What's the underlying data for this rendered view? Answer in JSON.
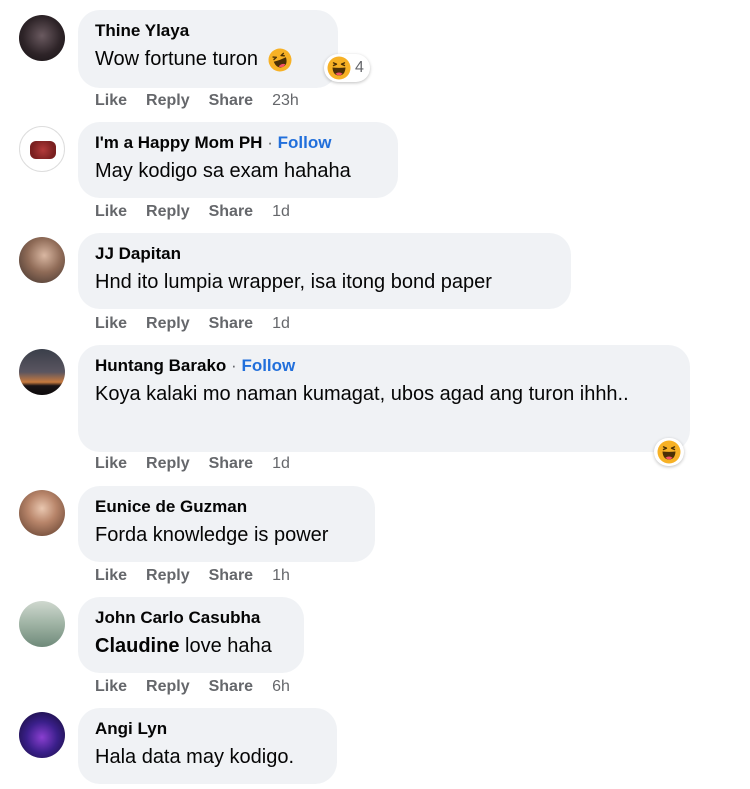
{
  "actions": {
    "like": "Like",
    "reply": "Reply",
    "share": "Share"
  },
  "comments": [
    {
      "author": "Thine Ylaya",
      "text": "Wow fortune turon",
      "time": "23h",
      "reaction_count": "4"
    },
    {
      "author": "I'm a Happy Mom PH",
      "follow": "Follow",
      "separator": "·",
      "text": "May kodigo sa exam hahaha",
      "time": "1d"
    },
    {
      "author": "JJ Dapitan",
      "text": "Hnd ito lumpia wrapper, isa itong bond paper",
      "time": "1d"
    },
    {
      "author": "Huntang Barako",
      "follow": "Follow",
      "separator": "·",
      "text": "Koya kalaki mo naman kumagat, ubos agad ang turon ihhh..",
      "time": "1d"
    },
    {
      "author": "Eunice de Guzman",
      "text": "Forda knowledge is power",
      "time": "1h"
    },
    {
      "author": "John Carlo Casubha",
      "mention": "Claudine",
      "text": " love haha",
      "time": "6h"
    },
    {
      "author": "Angi Lyn",
      "text": "Hala data may kodigo."
    }
  ],
  "colors": {
    "bubble": "#f0f2f5",
    "meta": "#65676b",
    "follow": "#216fdb",
    "reaction": "#f7b125"
  },
  "icons": {
    "laugh": "laughing-emoji-icon",
    "rofl": "rofl-emoji-icon"
  }
}
